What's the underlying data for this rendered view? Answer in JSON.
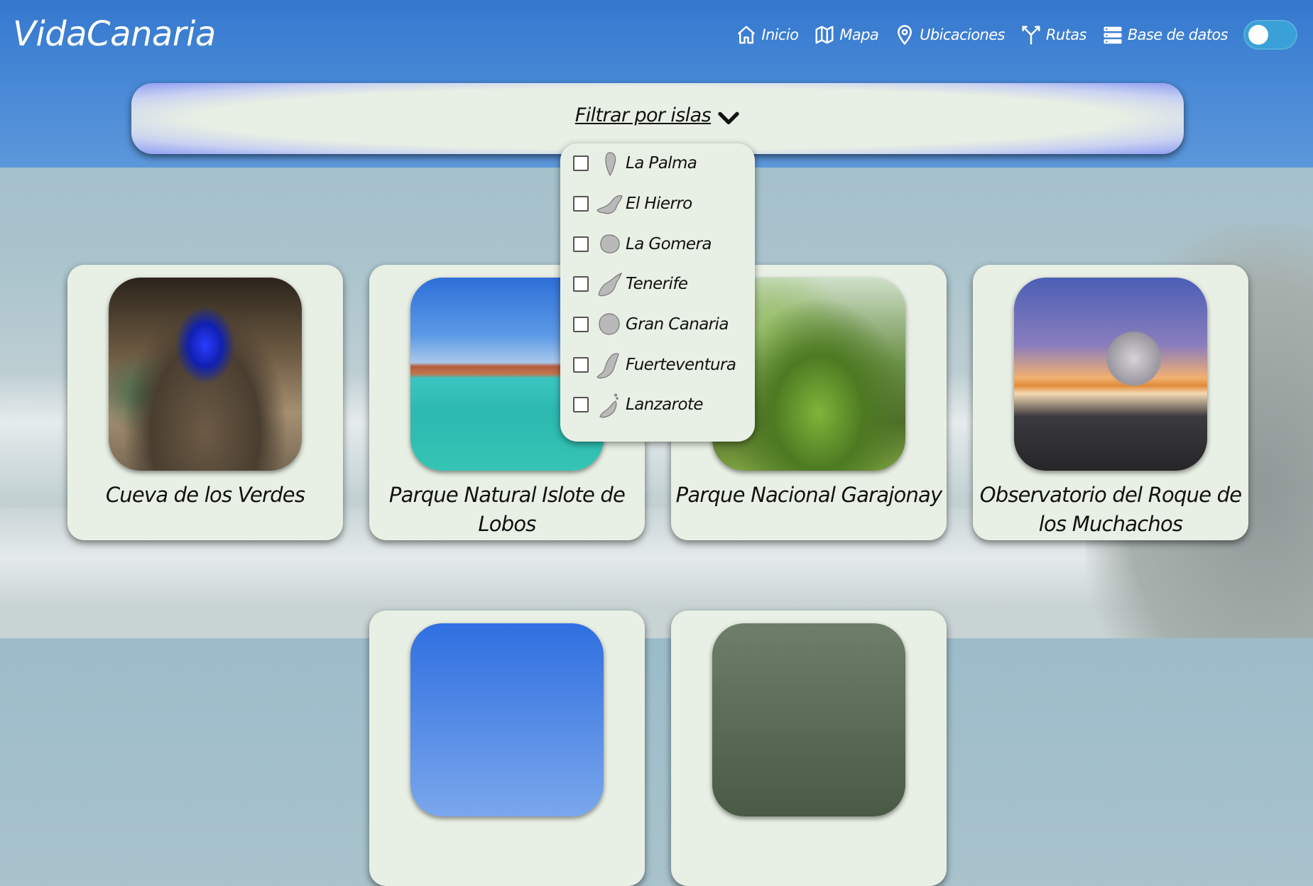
{
  "header": {
    "logo": "VidaCanaria",
    "nav": [
      {
        "label": "Inicio",
        "icon": "home-icon"
      },
      {
        "label": "Mapa",
        "icon": "map-icon"
      },
      {
        "label": "Ubicaciones",
        "icon": "location-pin-icon"
      },
      {
        "label": "Rutas",
        "icon": "route-fork-icon"
      },
      {
        "label": "Base de datos",
        "icon": "database-list-icon"
      }
    ],
    "theme_toggle": {
      "state": "off"
    }
  },
  "filter": {
    "label": "Filtrar por islas",
    "icon": "chevron-down-icon",
    "islands": [
      {
        "label": "La Palma",
        "checked": false,
        "icon": "la-palma-island-icon"
      },
      {
        "label": "El Hierro",
        "checked": false,
        "icon": "el-hierro-island-icon"
      },
      {
        "label": "La Gomera",
        "checked": false,
        "icon": "la-gomera-island-icon"
      },
      {
        "label": "Tenerife",
        "checked": false,
        "icon": "tenerife-island-icon"
      },
      {
        "label": "Gran Canaria",
        "checked": false,
        "icon": "gran-canaria-island-icon"
      },
      {
        "label": "Fuerteventura",
        "checked": false,
        "icon": "fuerteventura-island-icon"
      },
      {
        "label": "Lanzarote",
        "checked": false,
        "icon": "lanzarote-island-icon"
      }
    ]
  },
  "cards": [
    {
      "title": "Cueva de los Verdes"
    },
    {
      "title": "Parque Natural Islote de Lobos"
    },
    {
      "title": "Parque Nacional Garajonay"
    },
    {
      "title": "Observatorio del Roque de los Muchachos"
    },
    {
      "title": ""
    },
    {
      "title": ""
    }
  ],
  "colors": {
    "header": "#3478cf",
    "card": "#e8efe4",
    "toggle": "#3aa0d8"
  }
}
